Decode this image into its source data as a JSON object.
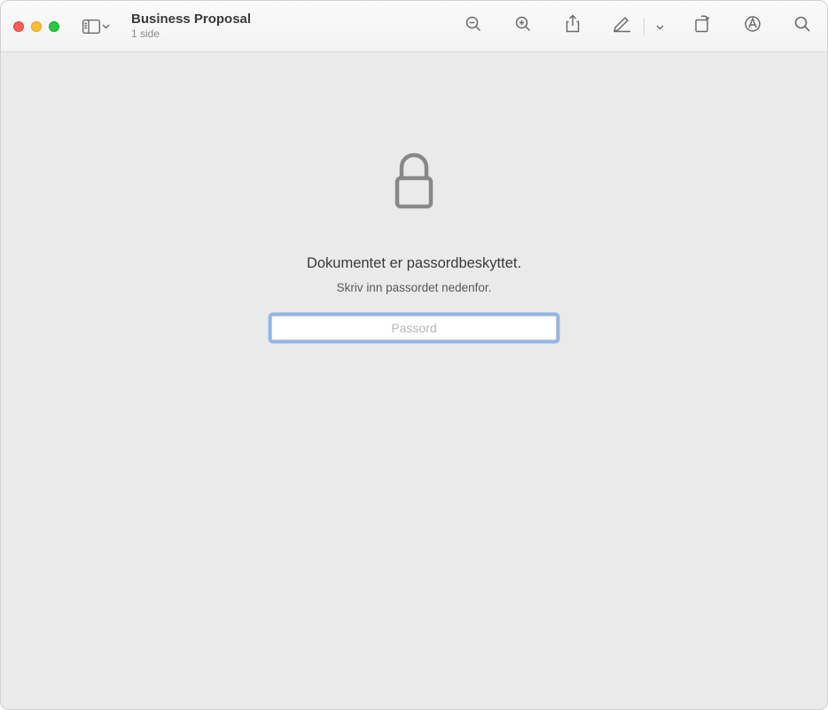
{
  "titlebar": {
    "doc_title": "Business Proposal",
    "doc_subtitle": "1 side"
  },
  "content": {
    "primary_message": "Dokumentet er passordbeskyttet.",
    "secondary_message": "Skriv inn passordet nedenfor.",
    "password_placeholder": "Passord"
  }
}
